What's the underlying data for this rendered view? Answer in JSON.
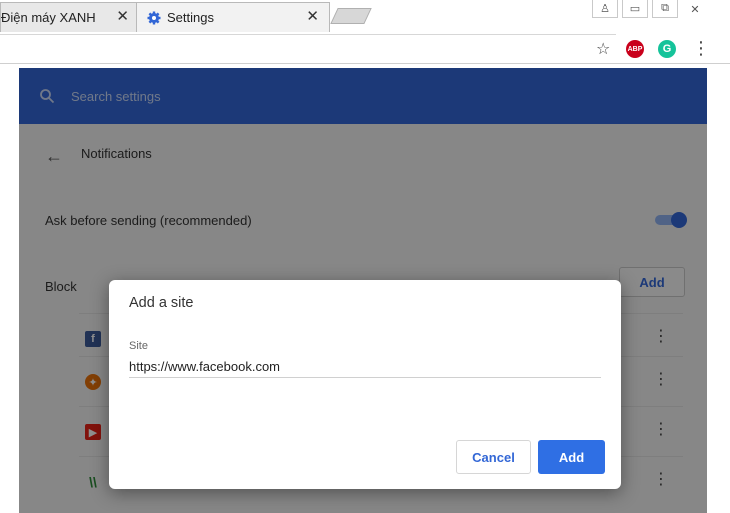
{
  "browser": {
    "tabs": [
      {
        "title": "Điện máy XANH",
        "close": "✕"
      },
      {
        "title": "Settings",
        "close": "✕"
      }
    ],
    "window_controls": [
      "♙",
      "▭",
      "⧉",
      "✕"
    ],
    "toolbar": {
      "star_icon": "☆",
      "abp_label": "ABP",
      "grammarly_label": "G",
      "menu_icon": "⋮"
    }
  },
  "settings": {
    "search_placeholder": "Search settings",
    "back_icon": "←",
    "subpage_title": "Notifications",
    "ask_before_sending": "Ask before sending (recommended)",
    "ask_before_sending_enabled": true,
    "block_label": "Block",
    "add_label": "Add",
    "blocked_sites": [
      {
        "icon": "facebook-icon",
        "glyph": "f",
        "color": "#3b5998"
      },
      {
        "icon": "site-icon-orange",
        "glyph": "✦",
        "color": "#e8710a"
      },
      {
        "icon": "youtube-icon",
        "glyph": "▶",
        "color": "#e62117"
      },
      {
        "icon": "site-icon-green",
        "glyph": "\\\\",
        "color": "#2e8b3a"
      }
    ],
    "kebab_icon": "⋮"
  },
  "dialog": {
    "title": "Add a site",
    "site_label": "Site",
    "site_value": "https://www.facebook.com",
    "cancel_label": "Cancel",
    "add_label": "Add"
  },
  "colors": {
    "accent": "#3367d6",
    "primary_button": "#2f6fe4"
  }
}
